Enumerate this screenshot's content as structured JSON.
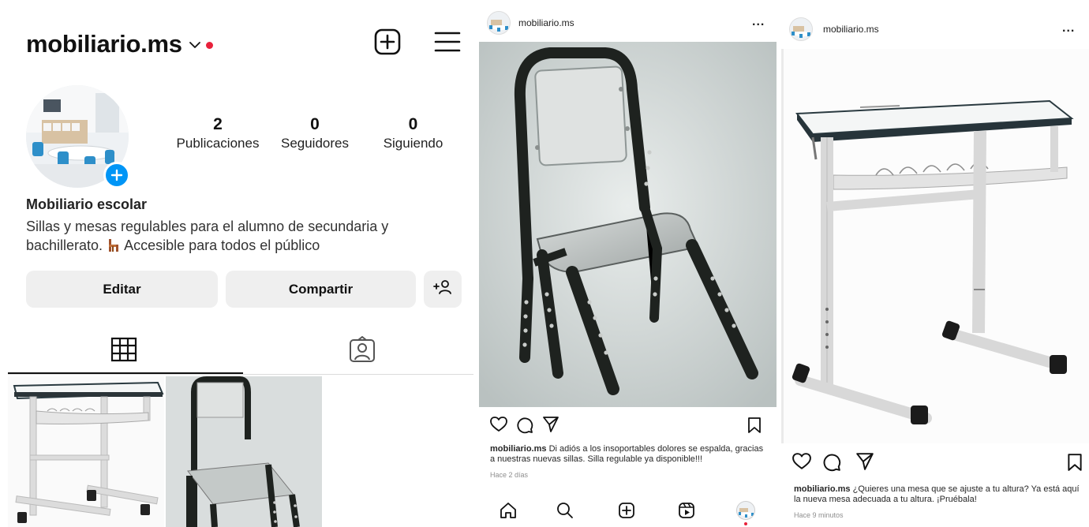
{
  "profile": {
    "username": "mobiliario.ms",
    "stats": [
      {
        "value": "2",
        "label": "Publicaciones"
      },
      {
        "value": "0",
        "label": "Seguidores"
      },
      {
        "value": "0",
        "label": "Siguiendo"
      }
    ],
    "display_name": "Mobiliario escolar",
    "bio_part1": "Sillas y mesas regulables para el alumno de secundaria y bachillerato.",
    "bio_part2": "Accesible para todos el público",
    "edit_label": "Editar",
    "share_label": "Compartir",
    "icons": [
      "chevron-down-icon",
      "notification-dot",
      "new-post-icon",
      "menu-icon",
      "add-avatar-icon",
      "add-person-icon",
      "grid-icon",
      "tagged-icon"
    ]
  },
  "posts": [
    {
      "username": "mobiliario.ms",
      "more": "...",
      "caption_user": "mobiliario.ms",
      "caption_text": "Di adiós a los insoportables dolores se espalda, gracias a nuestras nuevas sillas.  Silla regulable ya disponible!!!",
      "time": "Hace 2 días"
    },
    {
      "username": "mobiliario.ms",
      "more": "...",
      "caption_user": "mobiliario.ms",
      "caption_text": "¿Quieres una mesa que se ajuste a tu altura? Ya está aquí la nueva mesa adecuada a tu altura. ¡Pruébala!",
      "time": "Hace 9 minutos"
    }
  ],
  "bottom_nav": [
    "home-icon",
    "search-icon",
    "create-icon",
    "reels-icon",
    "profile-avatar"
  ],
  "colors": {
    "accent_blue": "#0095f6",
    "notification_red": "#e8213b",
    "button_gray": "#efefef",
    "chair_frame": "#1e221f",
    "desk_frame": "#dcdcdc"
  }
}
